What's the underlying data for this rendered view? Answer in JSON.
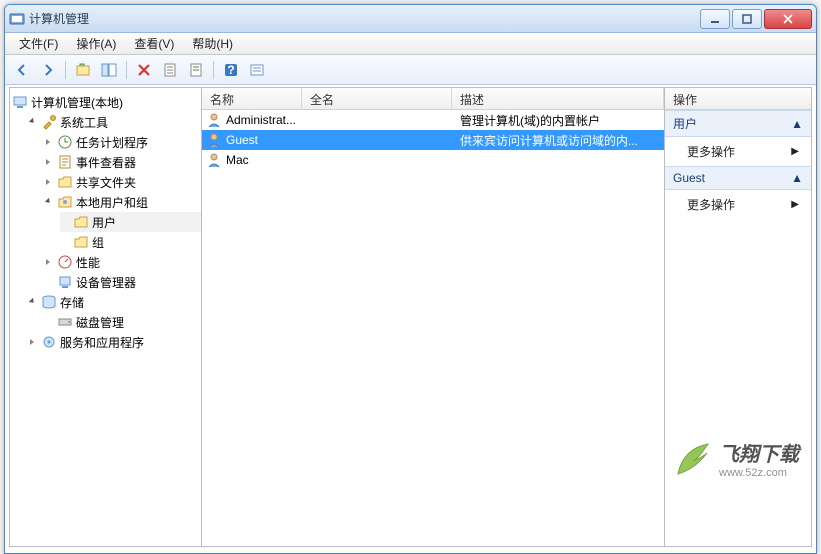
{
  "window": {
    "title": "计算机管理"
  },
  "menu": {
    "file": "文件(F)",
    "action": "操作(A)",
    "view": "查看(V)",
    "help": "帮助(H)"
  },
  "tree": {
    "root": "计算机管理(本地)",
    "system_tools": "系统工具",
    "task_scheduler": "任务计划程序",
    "event_viewer": "事件查看器",
    "shared_folders": "共享文件夹",
    "local_users_groups": "本地用户和组",
    "users": "用户",
    "groups": "组",
    "performance": "性能",
    "device_manager": "设备管理器",
    "storage": "存储",
    "disk_management": "磁盘管理",
    "services_apps": "服务和应用程序"
  },
  "columns": {
    "name": "名称",
    "full_name": "全名",
    "description": "描述"
  },
  "users_list": [
    {
      "name": "Administrat...",
      "full_name": "",
      "description": "管理计算机(域)的内置帐户",
      "selected": false
    },
    {
      "name": "Guest",
      "full_name": "",
      "description": "供来宾访问计算机或访问域的内...",
      "selected": true
    },
    {
      "name": "Mac",
      "full_name": "",
      "description": "",
      "selected": false
    }
  ],
  "actions": {
    "header": "操作",
    "section1": "用户",
    "more1": "更多操作",
    "section2": "Guest",
    "more2": "更多操作"
  },
  "watermark": {
    "brand": "飞翔下载",
    "url": "www.52z.com"
  },
  "icons": {
    "back": "back-icon",
    "forward": "forward-icon",
    "up": "up-icon",
    "props": "props-icon",
    "delete": "delete-icon",
    "refresh": "refresh-icon",
    "export": "export-icon",
    "help": "help-icon",
    "list": "list-icon"
  }
}
